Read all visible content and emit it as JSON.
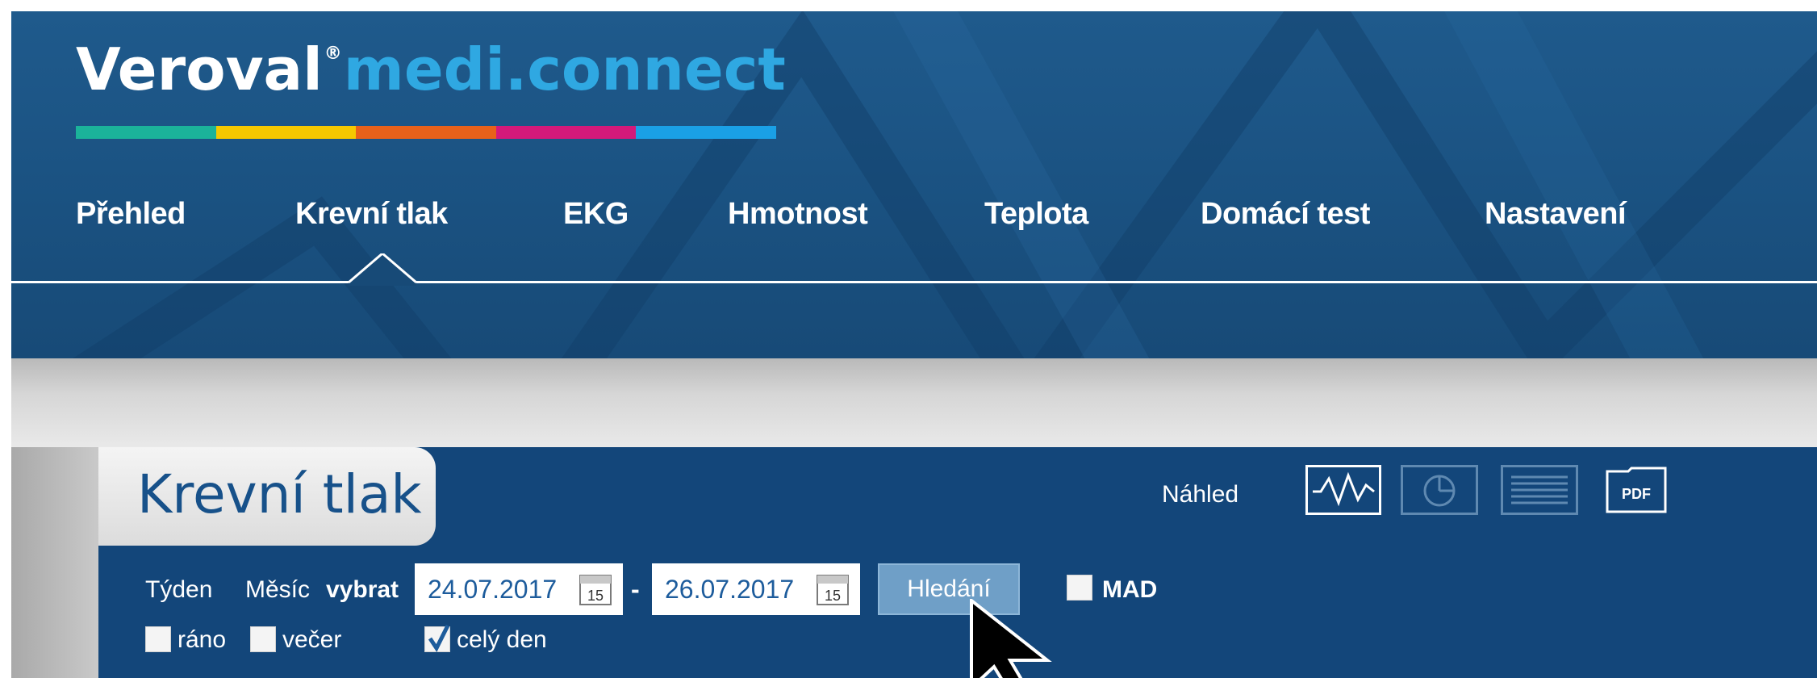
{
  "brand": {
    "name": "Veroval",
    "registered": "®",
    "product": "medi.connect",
    "color_bar": [
      "#1bb39a",
      "#f5c800",
      "#e8611a",
      "#d4197a",
      "#1aa0e6"
    ]
  },
  "nav": {
    "items": [
      {
        "label": "Přehled"
      },
      {
        "label": "Krevní tlak",
        "active": true
      },
      {
        "label": "EKG"
      },
      {
        "label": "Hmotnost"
      },
      {
        "label": "Teplota"
      },
      {
        "label": "Domácí test"
      },
      {
        "label": "Nastavení"
      }
    ]
  },
  "panel": {
    "title": "Krevní tlak",
    "preview_label": "Náhled",
    "view_buttons": [
      {
        "icon": "line-chart-icon",
        "active": true
      },
      {
        "icon": "pie-chart-icon",
        "active": false
      },
      {
        "icon": "table-icon",
        "active": false
      },
      {
        "icon": "pdf-icon",
        "label": "PDF",
        "active": false
      }
    ]
  },
  "filter": {
    "week_label": "Týden",
    "month_label": "Měsíc",
    "choose_label": "vybrat",
    "date_from": "24.07.2017",
    "date_to": "26.07.2017",
    "calendar_day": "15",
    "separator": "-",
    "search_label": "Hledání",
    "mad": {
      "label": "MAD",
      "checked": false
    },
    "morning": {
      "label": "ráno",
      "checked": false
    },
    "evening": {
      "label": "večer",
      "checked": false
    },
    "whole_day": {
      "label": "celý den",
      "checked": true
    }
  },
  "colors": {
    "header": "#1b5383",
    "panel": "#13467a",
    "accent": "#2fa8e2",
    "title": "#17518a",
    "search_button": "#6f9fc7"
  }
}
